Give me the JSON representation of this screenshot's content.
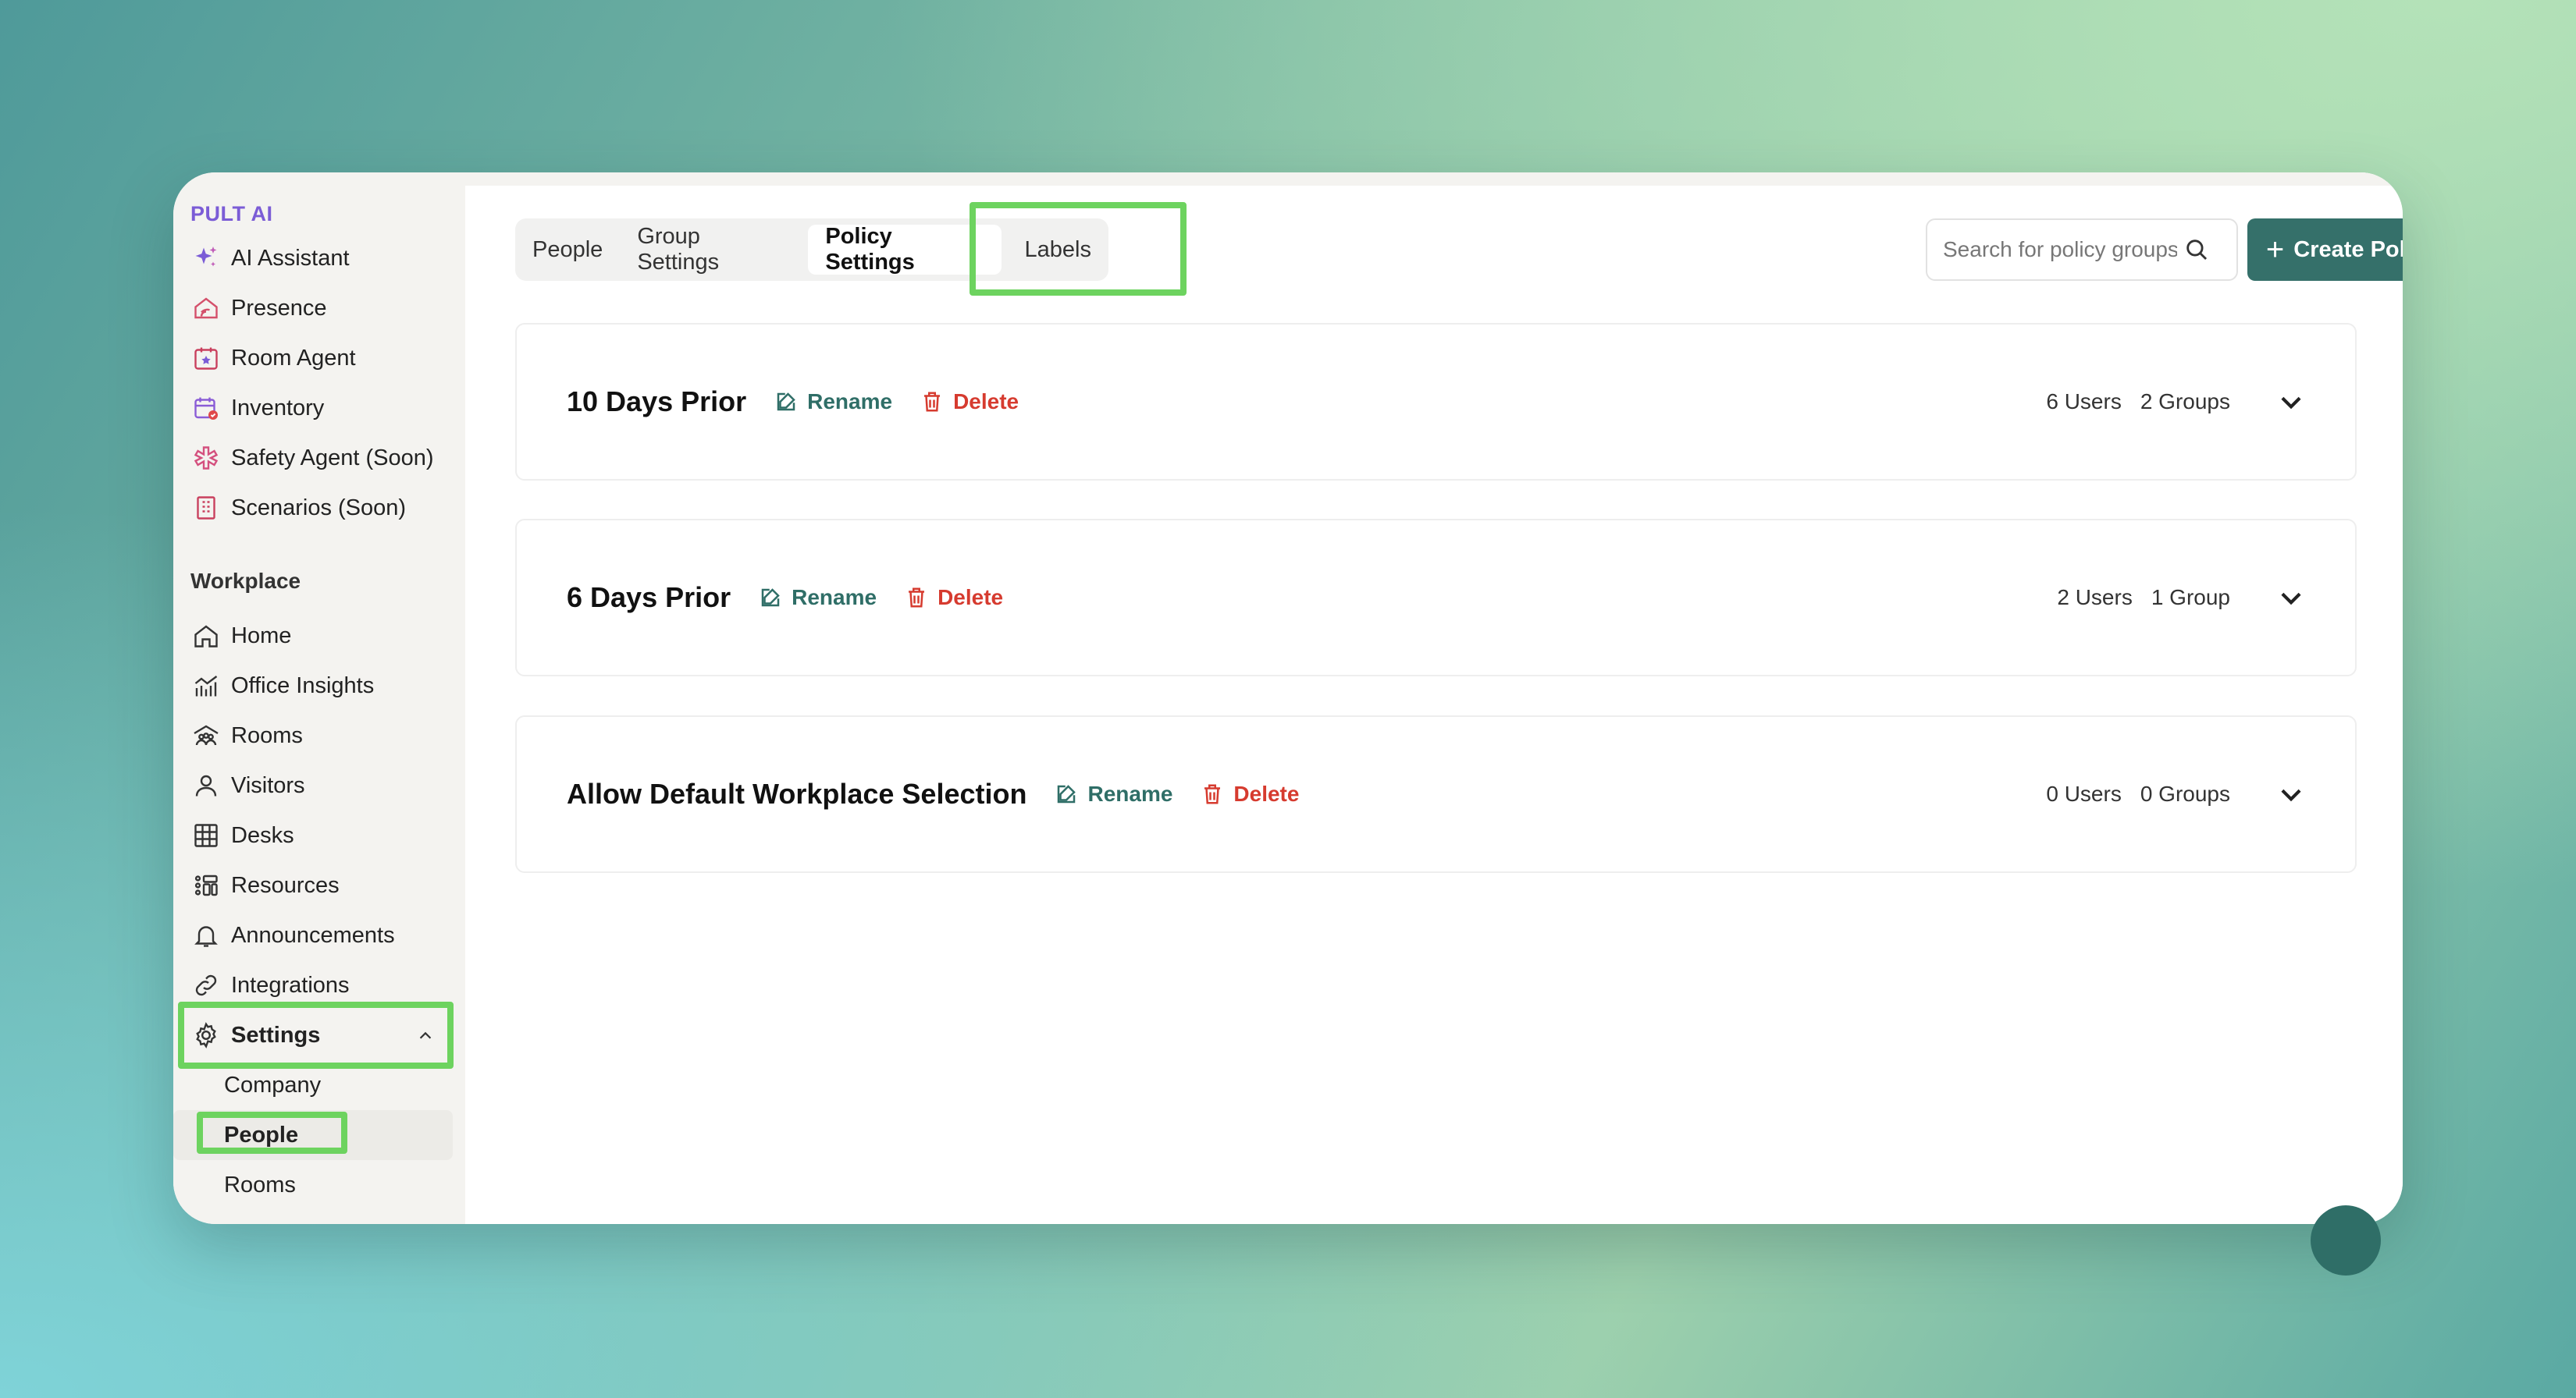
{
  "sidebar": {
    "brand": "PULT AI",
    "ai_items": [
      {
        "label": "AI Assistant",
        "icon": "sparkle-icon"
      },
      {
        "label": "Presence",
        "icon": "home-signal-icon"
      },
      {
        "label": "Room Agent",
        "icon": "calendar-star-icon"
      },
      {
        "label": "Inventory",
        "icon": "calendar-check-icon"
      },
      {
        "label": "Safety Agent (Soon)",
        "icon": "asterisk-icon"
      },
      {
        "label": "Scenarios (Soon)",
        "icon": "building-icon"
      }
    ],
    "workplace_title": "Workplace",
    "workplace_items": [
      {
        "label": "Home",
        "icon": "home-icon"
      },
      {
        "label": "Office Insights",
        "icon": "chart-icon"
      },
      {
        "label": "Rooms",
        "icon": "rooms-icon"
      },
      {
        "label": "Visitors",
        "icon": "user-icon"
      },
      {
        "label": "Desks",
        "icon": "desk-grid-icon"
      },
      {
        "label": "Resources",
        "icon": "resources-icon"
      },
      {
        "label": "Announcements",
        "icon": "bell-icon"
      },
      {
        "label": "Integrations",
        "icon": "link-icon"
      }
    ],
    "settings_label": "Settings",
    "settings_sub": [
      "Company",
      "People",
      "Rooms"
    ]
  },
  "tabs": [
    "People",
    "Group Settings",
    "Policy Settings",
    "Labels"
  ],
  "search": {
    "placeholder": "Search for policy groups"
  },
  "create_button": "Create Policy Group",
  "actions": {
    "rename": "Rename",
    "delete": "Delete"
  },
  "policy_groups": [
    {
      "name": "10 Days Prior",
      "users": "6 Users",
      "groups": "2 Groups"
    },
    {
      "name": "6 Days Prior",
      "users": "2 Users",
      "groups": "1 Group"
    },
    {
      "name": "Allow Default Workplace Selection",
      "users": "0 Users",
      "groups": "0 Groups"
    }
  ],
  "colors": {
    "accent": "#35706a",
    "delete": "#d63b2f",
    "highlight": "#6dd35f",
    "brand": "#7b5cd6"
  }
}
